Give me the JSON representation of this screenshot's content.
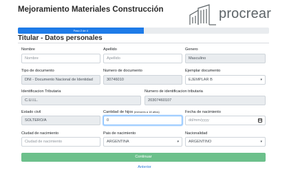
{
  "header": {
    "title": "Mejoramiento Materiales Construcción",
    "logo_text": "procrear"
  },
  "progress": {
    "label": "Paso 2 de 4",
    "fraction": 0.5,
    "color": "#1e7be8"
  },
  "section": {
    "title": "Titular - Datos personales"
  },
  "fields": {
    "nombre": {
      "label": "Nombre",
      "placeholder": "Nombre",
      "value": ""
    },
    "apellido": {
      "label": "Apellido",
      "placeholder": "Apellido",
      "value": ""
    },
    "genero": {
      "label": "Genero",
      "value": "Masculino"
    },
    "tipo_documento": {
      "label": "Tipo de documento",
      "value": "DNI - Documento Nacional de Identidad"
    },
    "numero_documento": {
      "label": "Numero de documento",
      "value": "30746010"
    },
    "ejemplar_documento": {
      "label": "Ejemplar documento",
      "value": "EJEMPLAR B"
    },
    "identificacion_tributaria": {
      "label": "Identificacion Tributaria",
      "value": "C.U.I.L."
    },
    "numero_identificacion": {
      "label": "Numero de identificacion tributaria",
      "value": "20307460107"
    },
    "estado_civil": {
      "label": "Estado civil",
      "value": "SOLTERO/A"
    },
    "cantidad_hijos": {
      "label": "Cantidad de hijos",
      "hint": "(menores a 18 años)",
      "value": "0"
    },
    "fecha_nacimiento": {
      "label": "Fecha de nacimiento",
      "placeholder": "dd/mm/yyyy",
      "value": ""
    },
    "ciudad_nacimiento": {
      "label": "Ciudad de nacimiento",
      "placeholder": "Ciudad de nacimiento",
      "value": ""
    },
    "pais_nacimiento": {
      "label": "Pais de nacimiento",
      "value": "ARGENTINA"
    },
    "nacionalidad": {
      "label": "Nacionalidad",
      "value": "ARGENTINO"
    }
  },
  "actions": {
    "continue_label": "Continuar",
    "back_label": "Anterior"
  },
  "colors": {
    "continue_button": "#6cc08b",
    "link": "#2a7ad6"
  }
}
